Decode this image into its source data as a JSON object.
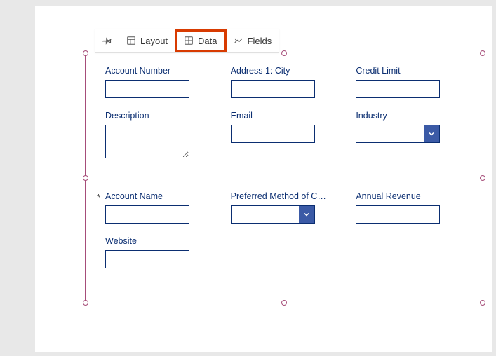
{
  "toolbar": {
    "layout_label": "Layout",
    "data_label": "Data",
    "fields_label": "Fields"
  },
  "fields": {
    "account_number": {
      "label": "Account Number",
      "value": ""
    },
    "address1_city": {
      "label": "Address 1: City",
      "value": ""
    },
    "credit_limit": {
      "label": "Credit Limit",
      "value": ""
    },
    "description": {
      "label": "Description",
      "value": ""
    },
    "email": {
      "label": "Email",
      "value": ""
    },
    "industry": {
      "label": "Industry",
      "value": ""
    },
    "account_name": {
      "label": "Account Name",
      "value": "",
      "required_marker": "*"
    },
    "pref_method": {
      "label": "Preferred Method of C…",
      "value": ""
    },
    "annual_revenue": {
      "label": "Annual Revenue",
      "value": ""
    },
    "website": {
      "label": "Website",
      "value": ""
    }
  }
}
